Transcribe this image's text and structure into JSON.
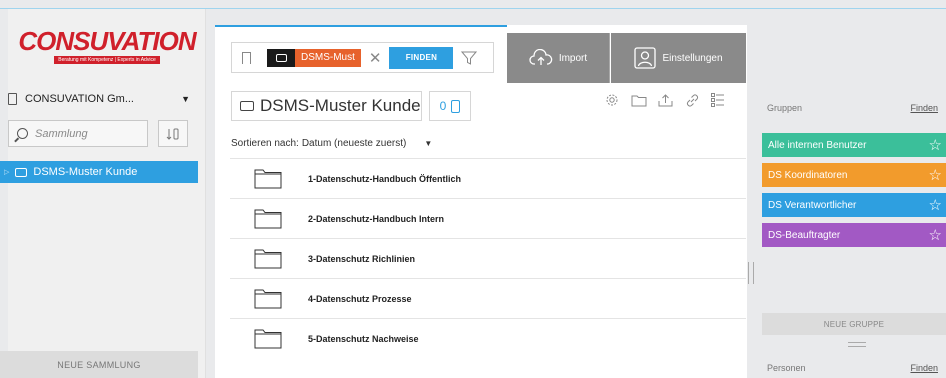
{
  "left": {
    "logo": {
      "text": "CONSUVATION",
      "tagline": "Beratung mit Kompetenz | Experts in Advice"
    },
    "account": {
      "label": "CONSUVATION Gm...",
      "caret": "▼"
    },
    "search": {
      "placeholder": "Sammlung"
    },
    "collections": [
      {
        "label": "DSMS-Muster Kunde",
        "selected": true
      }
    ],
    "new_collection": "NEUE SAMMLUNG"
  },
  "toolbar": {
    "tag_label": "DSMS-Must",
    "clear": "✕",
    "find_button": "FINDEN",
    "import_button": "Import",
    "settings_button": "Einstellungen"
  },
  "collection": {
    "title": "DSMS-Muster Kunde",
    "count": "0",
    "sort_label": "Sortieren nach:",
    "sort_value": "Datum (neueste zuerst)",
    "sort_caret": "▼",
    "folders": [
      "1-Datenschutz-Handbuch Öffentlich",
      "2-Datenschutz-Handbuch Intern",
      "3-Datenschutz Richlinien",
      "4-Datenschutz Prozesse",
      "5-Datenschutz Nachweise"
    ]
  },
  "groups": {
    "header": "Gruppen",
    "find": "Finden",
    "items": [
      {
        "label": "Alle internen Benutzer",
        "color": "#3bbf9a"
      },
      {
        "label": "DS Koordinatoren",
        "color": "#f29b2c"
      },
      {
        "label": "DS Verantwortlicher",
        "color": "#2e9fe0"
      },
      {
        "label": "DS-Beauftragter",
        "color": "#a259c4"
      }
    ],
    "new_group": "NEUE GRUPPE"
  },
  "persons": {
    "header": "Personen",
    "find": "Finden"
  },
  "colors": {
    "accent": "#2e9fe0",
    "brand": "#d0202b",
    "tag": "#e7622c",
    "button_gray": "#8a8a8a"
  }
}
